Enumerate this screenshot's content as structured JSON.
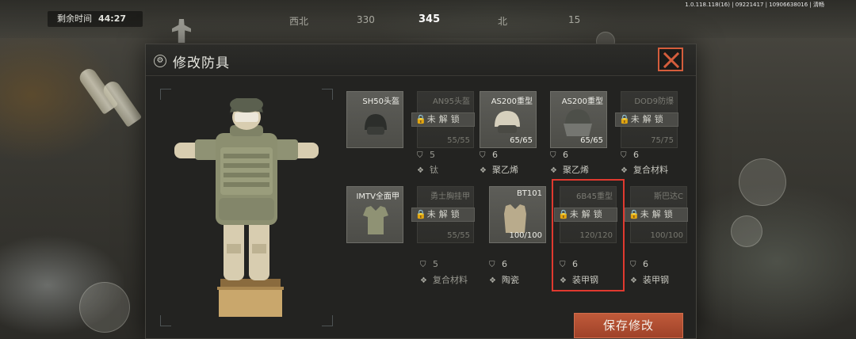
{
  "hud": {
    "version": "1.0.118.118(16) | 09221417 | 10906638016 | 清畅",
    "timer_label": "剩余时间",
    "timer_value": "44:27",
    "compass": [
      "西北",
      "330",
      "345",
      "北",
      "15"
    ]
  },
  "dialog": {
    "title": "修改防具",
    "save_label": "保存修改"
  },
  "lock_label": "未解锁",
  "helmets": [
    {
      "name": "SH50头盔",
      "locked": false,
      "durability": "",
      "armor": "",
      "material": ""
    },
    {
      "name": "AN95头盔",
      "locked": true,
      "durability": "55/55",
      "armor": "5",
      "material": "钛"
    },
    {
      "name": "AS200重型",
      "locked": false,
      "durability": "65/65",
      "armor": "6",
      "material": "聚乙烯"
    },
    {
      "name": "AS200重型",
      "locked": false,
      "durability": "65/65",
      "armor": "6",
      "material": "聚乙烯"
    },
    {
      "name": "DOD9防爆",
      "locked": true,
      "durability": "75/75",
      "armor": "6",
      "material": "复合材料"
    }
  ],
  "vests": [
    {
      "name": "IMTV全面甲",
      "locked": false,
      "durability": "",
      "armor": "",
      "material": ""
    },
    {
      "name": "勇士胸挂甲",
      "locked": true,
      "durability": "55/55",
      "armor": "5",
      "material": "复合材料"
    },
    {
      "name": "BT101",
      "locked": false,
      "durability": "100/100",
      "armor": "6",
      "material": "陶瓷"
    },
    {
      "name": "6B45重型",
      "locked": true,
      "durability": "120/120",
      "armor": "6",
      "material": "装甲钢"
    },
    {
      "name": "斯巴达C",
      "locked": true,
      "durability": "100/100",
      "armor": "6",
      "material": "装甲钢"
    }
  ],
  "colors": {
    "accent": "#c05a3a",
    "selection": "#e0392f",
    "close": "#d45d3c"
  }
}
